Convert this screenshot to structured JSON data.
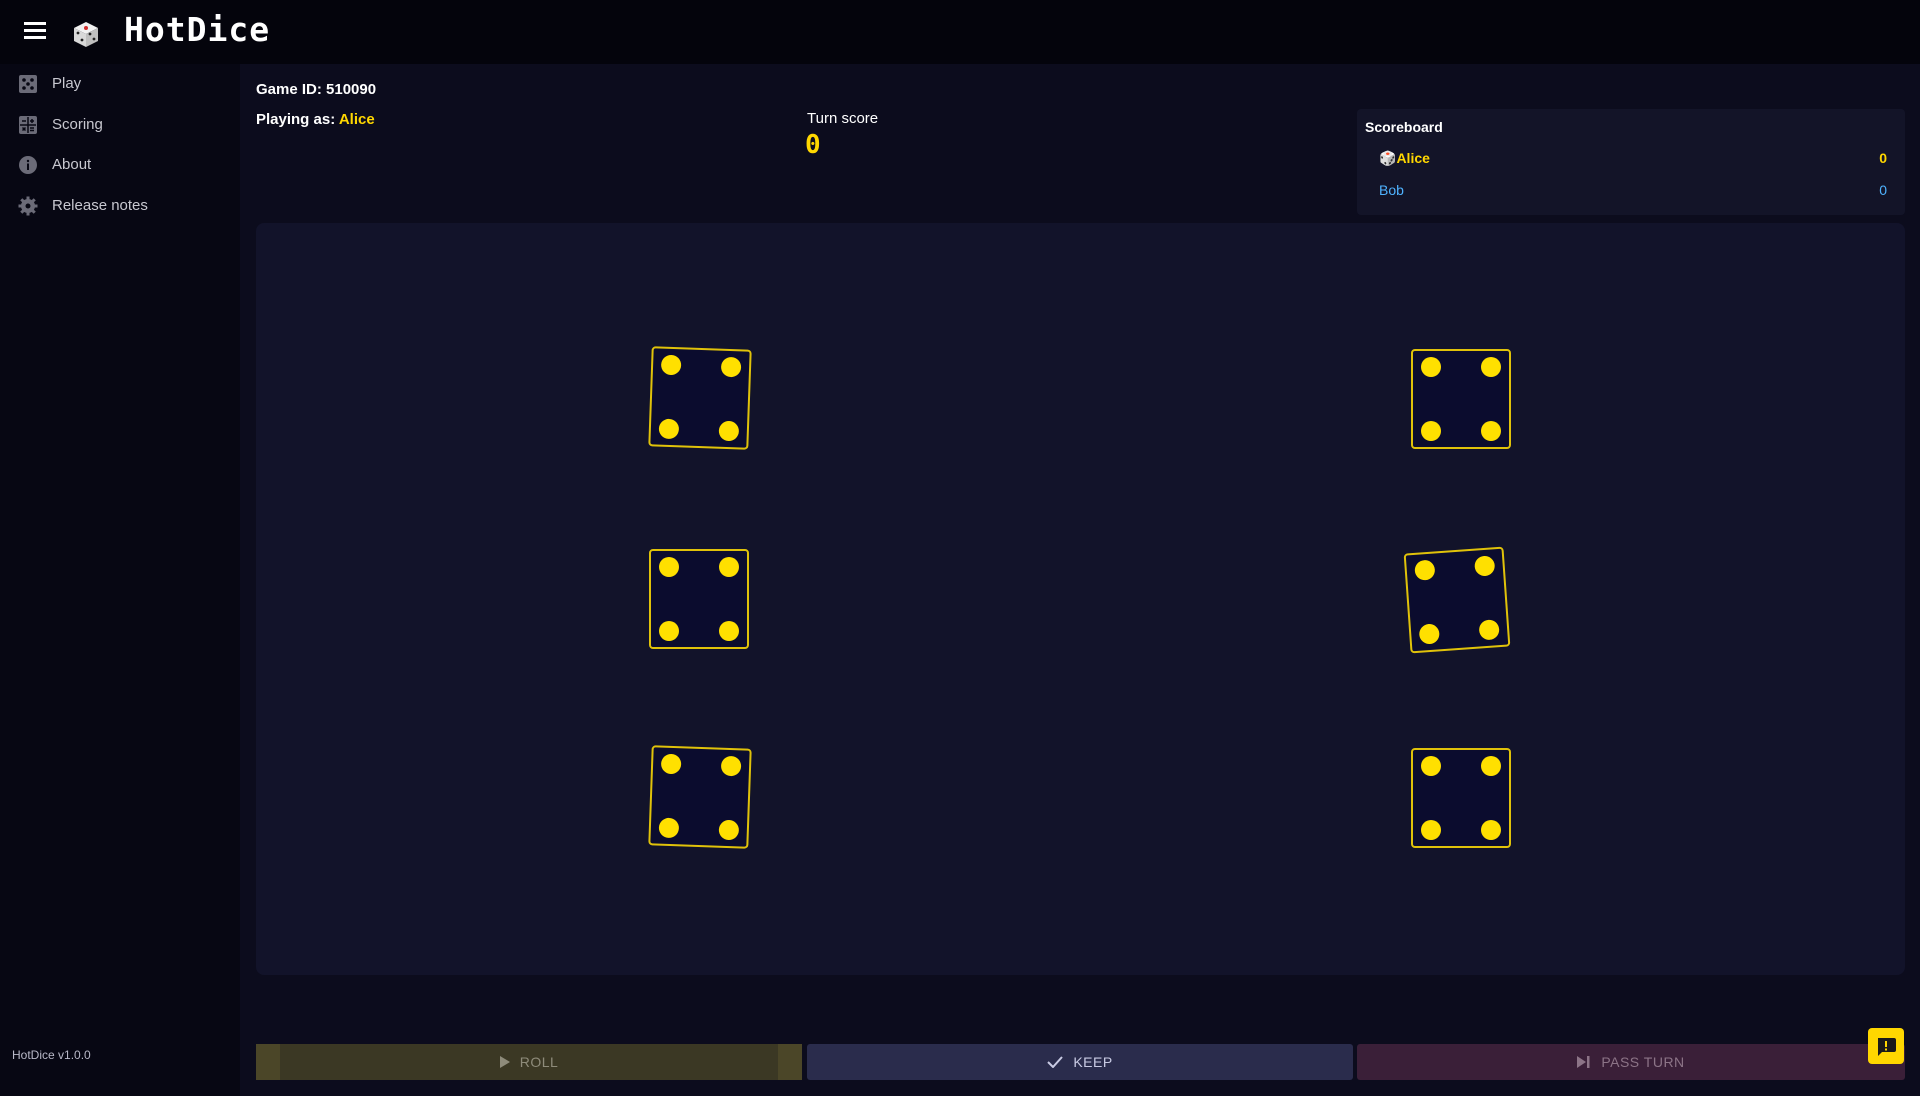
{
  "header": {
    "title": "HotDice",
    "menu_icon": "menu-icon",
    "logo_icon": "die-icon"
  },
  "sidebar": {
    "items": [
      {
        "label": "Play",
        "icon": "dice-icon"
      },
      {
        "label": "Scoring",
        "icon": "calculator-icon"
      },
      {
        "label": "About",
        "icon": "info-icon"
      },
      {
        "label": "Release notes",
        "icon": "gear-icon"
      }
    ],
    "version": "HotDice v1.0.0"
  },
  "game": {
    "game_id_label": "Game ID:",
    "game_id": "510090",
    "playing_as_label": "Playing as:",
    "player_name": "Alice",
    "turn_score_label": "Turn score",
    "turn_score": "0"
  },
  "scoreboard": {
    "title": "Scoreboard",
    "players": [
      {
        "name": "Alice",
        "score": "0",
        "current": true,
        "color": "#ffd700"
      },
      {
        "name": "Bob",
        "score": "0",
        "current": false,
        "color": "#4fb3ff"
      }
    ]
  },
  "dice": [
    {
      "value": 4
    },
    {
      "value": 4
    },
    {
      "value": 4
    },
    {
      "value": 4
    },
    {
      "value": 4
    },
    {
      "value": 4
    }
  ],
  "actions": {
    "roll": "ROLL",
    "keep": "KEEP",
    "pass": "PASS TURN"
  },
  "colors": {
    "accent": "#ffd700",
    "die_border": "#e0c20a",
    "pip": "#ffe000",
    "background": "#0c0c1d"
  }
}
